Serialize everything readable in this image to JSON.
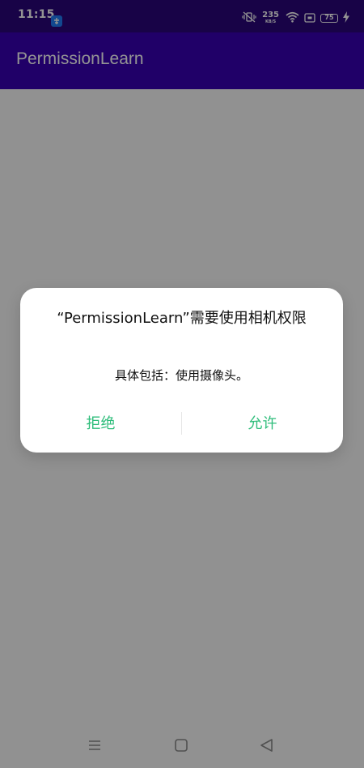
{
  "status_bar": {
    "time": "11:15",
    "net_speed_value": "235",
    "net_speed_unit": "KB/S",
    "battery_level": "75",
    "icons": [
      "app-notification-icon",
      "mute-vibrate-icon",
      "wifi-icon",
      "screen-cast-icon",
      "battery-icon",
      "charging-bolt-icon"
    ]
  },
  "app_bar": {
    "title": "PermissionLearn"
  },
  "dialog": {
    "title": "“PermissionLearn”需要使用相机权限",
    "message": "具体包括：使用摄像头。",
    "deny_label": "拒绝",
    "allow_label": "允许"
  },
  "nav_bar": {
    "icons": [
      "menu-icon",
      "home-icon",
      "back-icon"
    ]
  },
  "colors": {
    "status_bar": "#2a067a",
    "app_bar": "#3700b3",
    "button_text": "#2fbd7b",
    "scrim": "rgba(0,0,0,0.42)"
  }
}
